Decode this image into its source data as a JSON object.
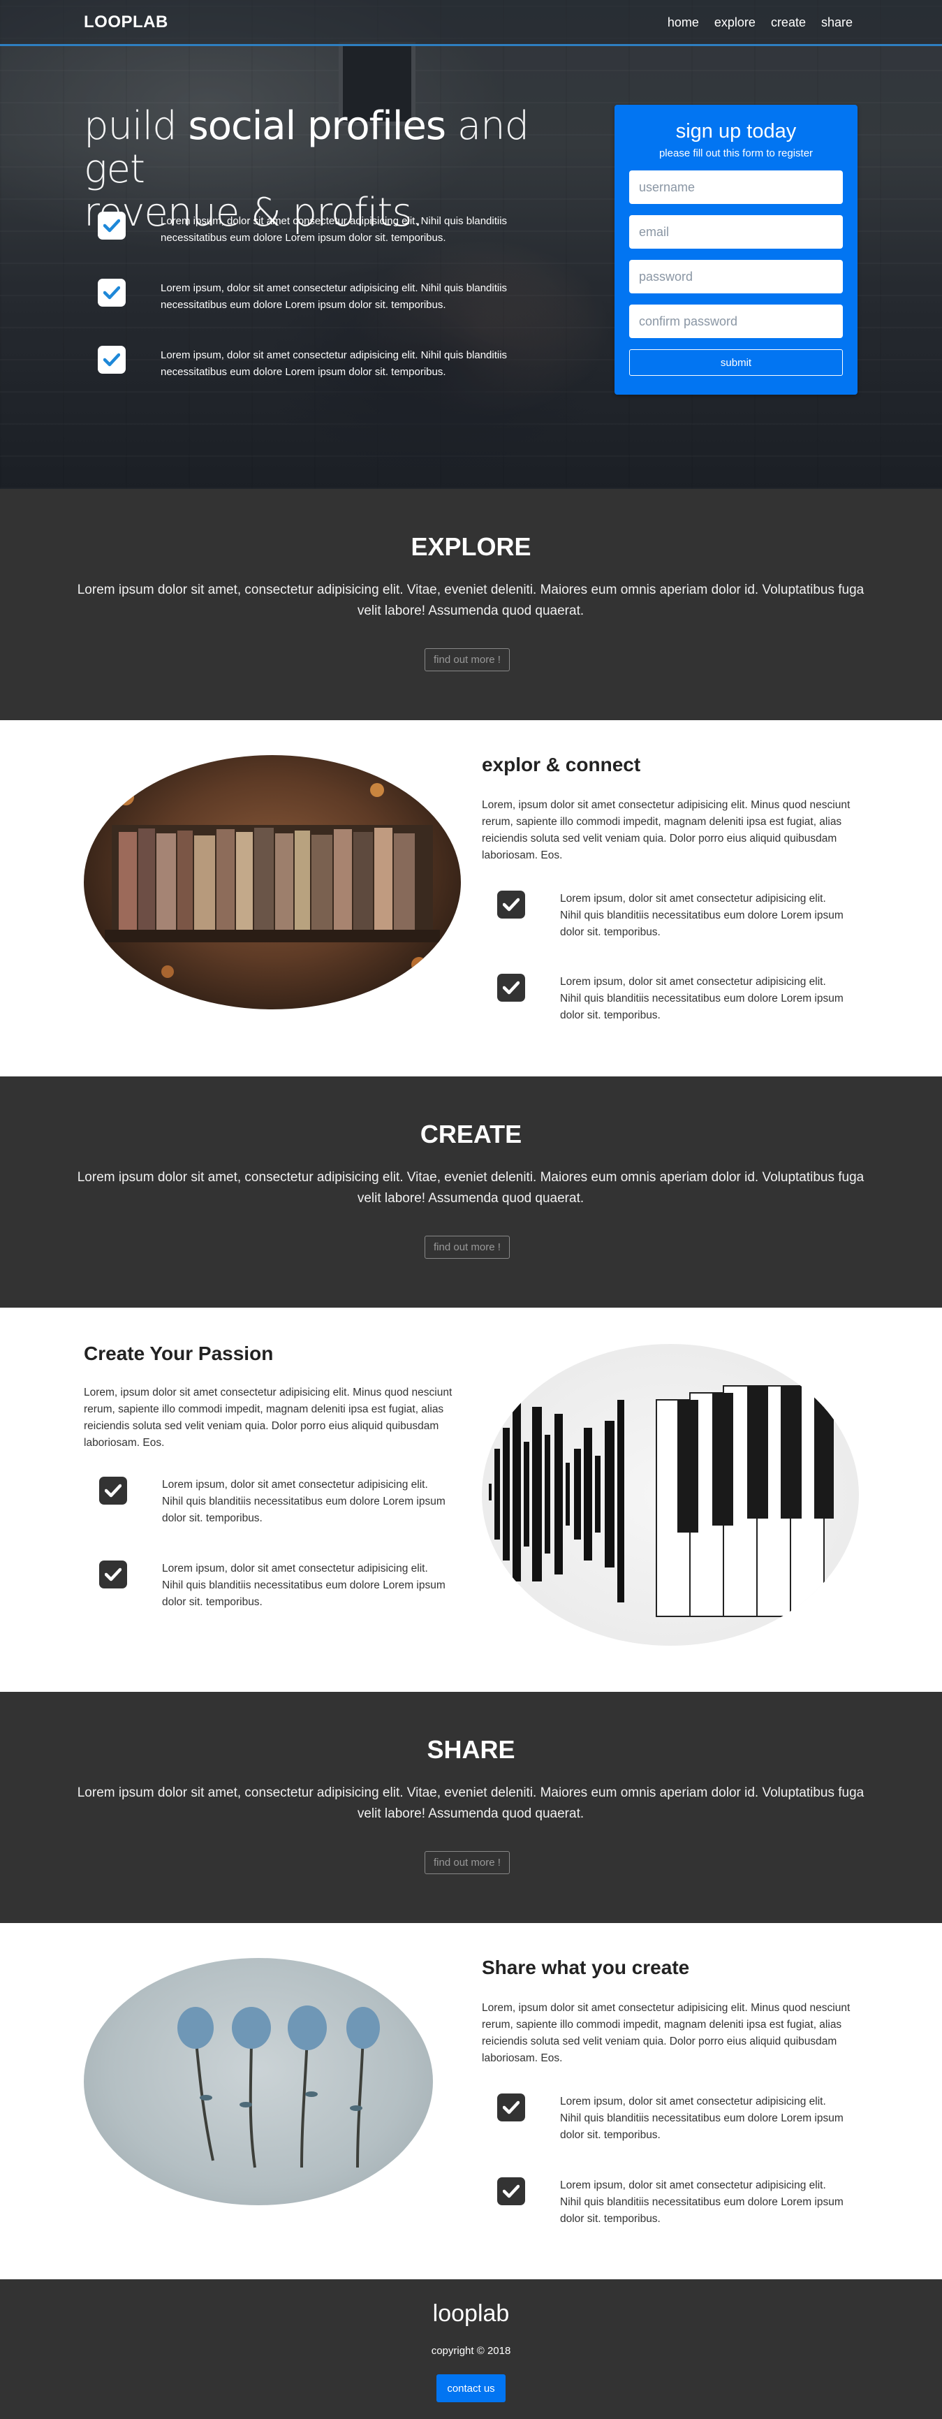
{
  "nav": {
    "brand": "LOOPLAB",
    "links": [
      "home",
      "explore",
      "create",
      "share"
    ]
  },
  "hero": {
    "title_part1": "puild ",
    "title_bold": "social profiles",
    "title_part2": " and get",
    "title_line2": "revenue & profits.",
    "features": [
      "Lorem ipsum, dolor sit amet consectetur adipisicing elit. Nihil quis blanditiis necessitatibus eum dolore Lorem ipsum dolor sit. temporibus.",
      "Lorem ipsum, dolor sit amet consectetur adipisicing elit. Nihil quis blanditiis necessitatibus eum dolore Lorem ipsum dolor sit. temporibus.",
      "Lorem ipsum, dolor sit amet consectetur adipisicing elit. Nihil quis blanditiis necessitatibus eum dolore Lorem ipsum dolor sit. temporibus."
    ]
  },
  "signup": {
    "title": "sign up today",
    "subtitle": "please fill out this form to register",
    "username_placeholder": "username",
    "email_placeholder": "email",
    "password_placeholder": "password",
    "confirm_placeholder": "confirm password",
    "submit_label": "submit"
  },
  "bands": {
    "explore": {
      "title": "EXPLORE",
      "text": "Lorem ipsum dolor sit amet, consectetur adipisicing elit. Vitae, eveniet deleniti. Maiores eum omnis aperiam dolor id. Voluptatibus fuga velit labore! Assumenda quod quaerat.",
      "button": "find out more !"
    },
    "create": {
      "title": "CREATE",
      "text": "Lorem ipsum dolor sit amet, consectetur adipisicing elit. Vitae, eveniet deleniti. Maiores eum omnis aperiam dolor id. Voluptatibus fuga velit labore! Assumenda quod quaerat.",
      "button": "find out more !"
    },
    "share": {
      "title": "SHARE",
      "text": "Lorem ipsum dolor sit amet, consectetur adipisicing elit. Vitae, eveniet deleniti. Maiores eum omnis aperiam dolor id. Voluptatibus fuga velit labore! Assumenda quod quaerat.",
      "button": "find out more !"
    }
  },
  "sections": {
    "explore": {
      "title": "explor & connect",
      "lead": "Lorem, ipsum dolor sit amet consectetur adipisicing elit. Minus quod nesciunt rerum, sapiente illo commodi impedit, magnam deleniti ipsa est fugiat, alias reiciendis soluta sed velit veniam quia. Dolor porro eius aliquid quibusdam laboriosam. Eos.",
      "features": [
        "Lorem ipsum, dolor sit amet consectetur adipisicing elit. Nihil quis blanditiis necessitatibus eum dolore Lorem ipsum dolor sit. temporibus.",
        "Lorem ipsum, dolor sit amet consectetur adipisicing elit. Nihil quis blanditiis necessitatibus eum dolore Lorem ipsum dolor sit. temporibus."
      ]
    },
    "create": {
      "title": "Create Your Passion",
      "lead": "Lorem, ipsum dolor sit amet consectetur adipisicing elit. Minus quod nesciunt rerum, sapiente illo commodi impedit, magnam deleniti ipsa est fugiat, alias reiciendis soluta sed velit veniam quia. Dolor porro eius aliquid quibusdam laboriosam. Eos.",
      "features": [
        "Lorem ipsum, dolor sit amet consectetur adipisicing elit. Nihil quis blanditiis necessitatibus eum dolore Lorem ipsum dolor sit. temporibus.",
        "Lorem ipsum, dolor sit amet consectetur adipisicing elit. Nihil quis blanditiis necessitatibus eum dolore Lorem ipsum dolor sit. temporibus."
      ]
    },
    "share": {
      "title": "Share what you create",
      "lead": "Lorem, ipsum dolor sit amet consectetur adipisicing elit. Minus quod nesciunt rerum, sapiente illo commodi impedit, magnam deleniti ipsa est fugiat, alias reiciendis soluta sed velit veniam quia. Dolor porro eius aliquid quibusdam laboriosam. Eos.",
      "features": [
        "Lorem ipsum, dolor sit amet consectetur adipisicing elit. Nihil quis blanditiis necessitatibus eum dolore Lorem ipsum dolor sit. temporibus.",
        "Lorem ipsum, dolor sit amet consectetur adipisicing elit. Nihil quis blanditiis necessitatibus eum dolore Lorem ipsum dolor sit. temporibus."
      ]
    }
  },
  "footer": {
    "logo": "looplab",
    "copyright": "copyright © 2018",
    "contact_label": "contact us"
  },
  "colors": {
    "accent": "#0275f2",
    "check_blue": "#1e88d8",
    "dark_band": "#333333"
  }
}
